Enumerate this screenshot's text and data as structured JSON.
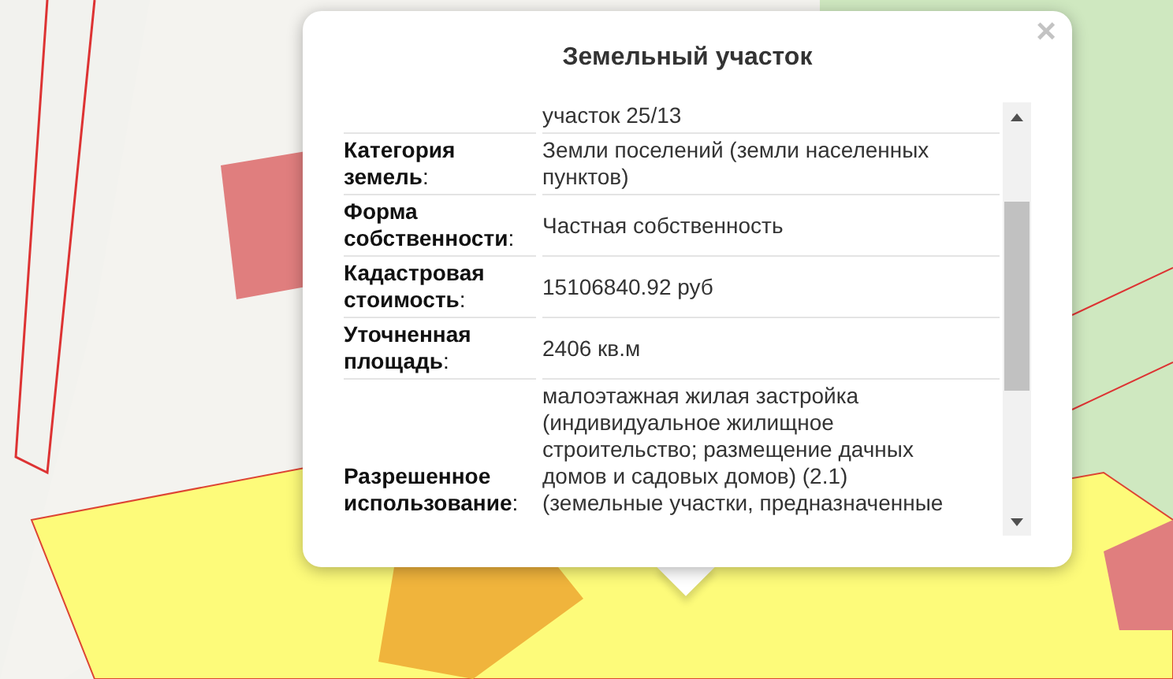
{
  "popup": {
    "title": "Земельный участок",
    "close_label": "×",
    "rows": [
      {
        "value": "участок 25/13"
      },
      {
        "label": "**Категория земель**:",
        "value": "Земли поселений (земли населенных пунктов)"
      },
      {
        "label": "**Форма собственности**:",
        "value": "Частная собственность"
      },
      {
        "label": "**Кадастровая стоимость**:",
        "value": "15106840.92 руб"
      },
      {
        "label": "**Уточненная площадь**:",
        "value": "2406 кв.м"
      },
      {
        "label": "**Разрешенное использование**:",
        "value": "малоэтажная жилая застройка (индивидуальное жилищное строительство; размещение дачных домов и садовых домов) (2.1) (земельные участки, предназначенные"
      }
    ]
  }
}
